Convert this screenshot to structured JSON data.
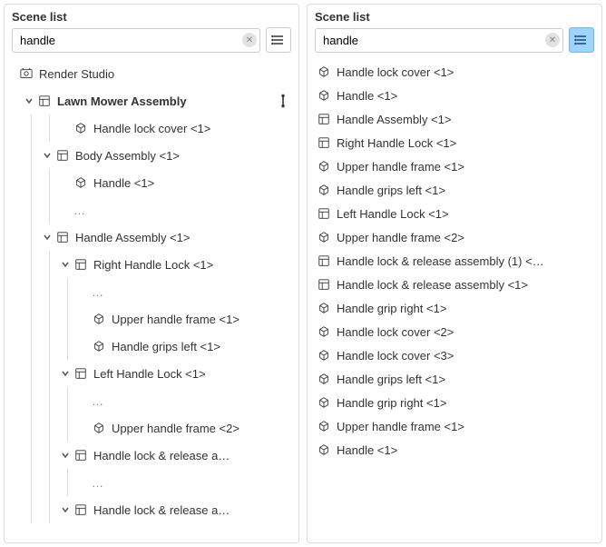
{
  "left": {
    "title": "Scene list",
    "search_value": "handle",
    "show_joint_toggle": true,
    "tree": [
      {
        "icon": "studio",
        "label": "Render Studio",
        "depth": 0,
        "has_chevron": false,
        "bold": false,
        "right_icon": null
      },
      {
        "icon": "assembly",
        "label": "Lawn Mower Assembly",
        "depth": 1,
        "has_chevron": true,
        "bold": true,
        "right_icon": "joint"
      },
      {
        "icon": "part",
        "label": "Handle lock cover <1>",
        "depth": 3,
        "has_chevron": false,
        "bold": false
      },
      {
        "icon": "assembly",
        "label": "Body Assembly <1>",
        "depth": 2,
        "has_chevron": true,
        "bold": false
      },
      {
        "icon": "part",
        "label": "Handle <1>",
        "depth": 3,
        "has_chevron": false,
        "bold": false
      },
      {
        "icon": "ellipsis",
        "label": "…",
        "depth": 3,
        "has_chevron": false,
        "bold": false,
        "ellipsis": true
      },
      {
        "icon": "assembly",
        "label": "Handle Assembly <1>",
        "depth": 2,
        "has_chevron": true,
        "bold": false
      },
      {
        "icon": "assembly",
        "label": "Right Handle Lock <1>",
        "depth": 3,
        "has_chevron": true,
        "bold": false
      },
      {
        "icon": "ellipsis",
        "label": "…",
        "depth": 4,
        "has_chevron": false,
        "bold": false,
        "ellipsis": true
      },
      {
        "icon": "part",
        "label": "Upper handle frame <1>",
        "depth": 4,
        "has_chevron": false,
        "bold": false
      },
      {
        "icon": "part",
        "label": "Handle grips left <1>",
        "depth": 4,
        "has_chevron": false,
        "bold": false
      },
      {
        "icon": "assembly",
        "label": "Left Handle Lock <1>",
        "depth": 3,
        "has_chevron": true,
        "bold": false
      },
      {
        "icon": "ellipsis",
        "label": "…",
        "depth": 4,
        "has_chevron": false,
        "bold": false,
        "ellipsis": true
      },
      {
        "icon": "part",
        "label": "Upper handle frame <2>",
        "depth": 4,
        "has_chevron": false,
        "bold": false
      },
      {
        "icon": "assembly",
        "label": "Handle lock & release a…",
        "depth": 3,
        "has_chevron": true,
        "bold": false
      },
      {
        "icon": "ellipsis",
        "label": "…",
        "depth": 4,
        "has_chevron": false,
        "bold": false,
        "ellipsis": true
      },
      {
        "icon": "assembly",
        "label": "Handle lock & release a…",
        "depth": 3,
        "has_chevron": true,
        "bold": false
      }
    ]
  },
  "right": {
    "title": "Scene list",
    "search_value": "handle",
    "view_toggle_active": true,
    "items": [
      {
        "icon": "part",
        "label": "Handle lock cover <1>"
      },
      {
        "icon": "part",
        "label": "Handle <1>"
      },
      {
        "icon": "assembly",
        "label": "Handle Assembly <1>"
      },
      {
        "icon": "assembly",
        "label": "Right Handle Lock <1>"
      },
      {
        "icon": "part",
        "label": "Upper handle frame <1>"
      },
      {
        "icon": "part",
        "label": "Handle grips left <1>"
      },
      {
        "icon": "assembly",
        "label": "Left Handle Lock <1>"
      },
      {
        "icon": "part",
        "label": "Upper handle frame <2>"
      },
      {
        "icon": "assembly",
        "label": "Handle lock & release assembly (1) <…"
      },
      {
        "icon": "assembly",
        "label": "Handle lock & release assembly <1>"
      },
      {
        "icon": "part",
        "label": "Handle grip right <1>"
      },
      {
        "icon": "part",
        "label": "Handle lock cover <2>"
      },
      {
        "icon": "part",
        "label": "Handle lock cover <3>"
      },
      {
        "icon": "part",
        "label": "Handle grips left <1>"
      },
      {
        "icon": "part",
        "label": "Handle grip right <1>"
      },
      {
        "icon": "part",
        "label": "Upper handle frame <1>",
        "struck": true
      },
      {
        "icon": "part",
        "label": "Handle <1>"
      }
    ]
  }
}
